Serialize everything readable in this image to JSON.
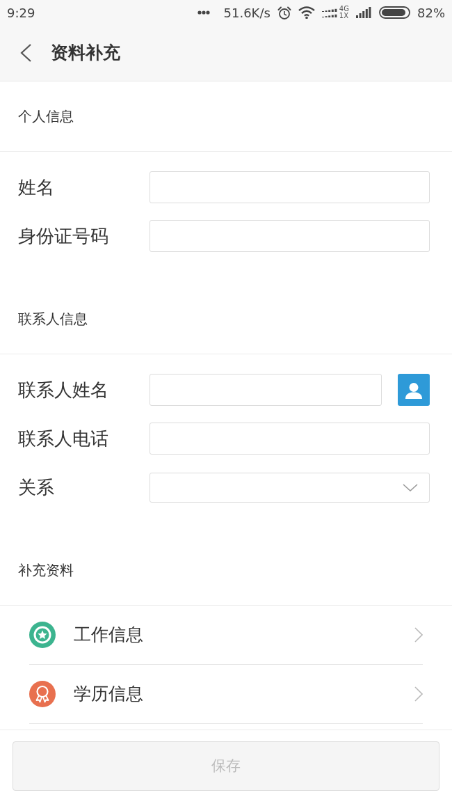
{
  "status_bar": {
    "time": "9:29",
    "network_speed": "51.6K/s",
    "network_types": [
      "4G",
      "1X"
    ],
    "battery": "82%"
  },
  "header": {
    "title": "资料补充"
  },
  "sections": [
    {
      "kind": "form",
      "title": "个人信息",
      "fields": [
        {
          "kind": "text",
          "label": "姓名"
        },
        {
          "kind": "text",
          "label": "身份证号码"
        }
      ]
    },
    {
      "kind": "form",
      "title": "联系人信息",
      "fields": [
        {
          "kind": "contact",
          "label": "联系人姓名"
        },
        {
          "kind": "text",
          "label": "联系人电话"
        },
        {
          "kind": "select",
          "label": "关系"
        }
      ]
    },
    {
      "kind": "list",
      "title": "补充资料",
      "items": [
        {
          "kind": "work",
          "label": "工作信息",
          "color": "#3cb48f"
        },
        {
          "kind": "education",
          "label": "学历信息",
          "color": "#e8704f"
        }
      ]
    }
  ],
  "save_button": {
    "label": "保存",
    "disabled": true
  }
}
